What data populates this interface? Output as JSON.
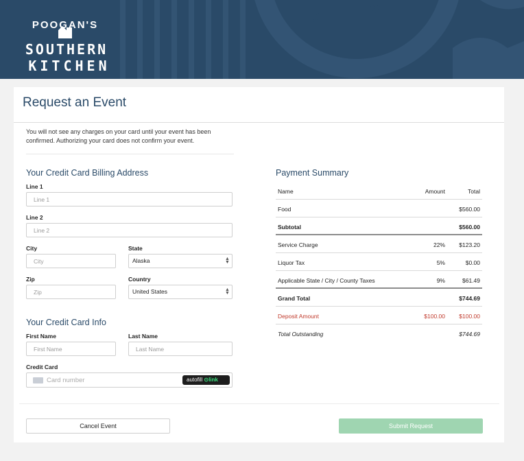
{
  "brand": {
    "logo_top": "POOGAN'S",
    "logo_mid": "SOUTHERN",
    "logo_bot": "KITCHEN",
    "banner_color": "#2a4a68"
  },
  "page": {
    "title": "Request an Event"
  },
  "notice": "You will not see any charges on your card until your event has been confirmed. Authorizing your card does not confirm your event.",
  "billing": {
    "title": "Your Credit Card Billing Address",
    "line1_label": "Line 1",
    "line1_placeholder": "Line 1",
    "line2_label": "Line 2",
    "line2_placeholder": "Line 2",
    "city_label": "City",
    "city_placeholder": "City",
    "state_label": "State",
    "state_value": "Alaska",
    "zip_label": "Zip",
    "zip_placeholder": "Zip",
    "country_label": "Country",
    "country_value": "United States"
  },
  "card_info": {
    "title": "Your Credit Card Info",
    "first_name_label": "First Name",
    "first_name_placeholder": "First Name",
    "last_name_label": "Last Name",
    "last_name_placeholder": "Last Name",
    "credit_card_label": "Credit Card",
    "card_number_placeholder": "Card number",
    "autofill_label": "autofill",
    "link_label": "link"
  },
  "summary": {
    "title": "Payment Summary",
    "header": {
      "name": "Name",
      "amount": "Amount",
      "total": "Total"
    },
    "rows": [
      {
        "name": "Food",
        "amount": "",
        "total": "$560.00"
      },
      {
        "name": "Subtotal",
        "amount": "",
        "total": "$560.00"
      },
      {
        "name": "Service Charge",
        "amount": "22%",
        "total": "$123.20"
      },
      {
        "name": "Liquor Tax",
        "amount": "5%",
        "total": "$0.00"
      },
      {
        "name": "Applicable State / City / County Taxes",
        "amount": "9%",
        "total": "$61.49"
      },
      {
        "name": "Grand Total",
        "amount": "",
        "total": "$744.69"
      },
      {
        "name": "Deposit Amount",
        "amount": "$100.00",
        "total": "$100.00"
      },
      {
        "name": "Total Outstanding",
        "amount": "",
        "total": "$744.69"
      }
    ]
  },
  "buttons": {
    "cancel": "Cancel Event",
    "submit": "Submit Request"
  },
  "colors": {
    "accent": "#2a4a68",
    "submit": "#9fd5b1",
    "deposit": "#c0392b"
  }
}
